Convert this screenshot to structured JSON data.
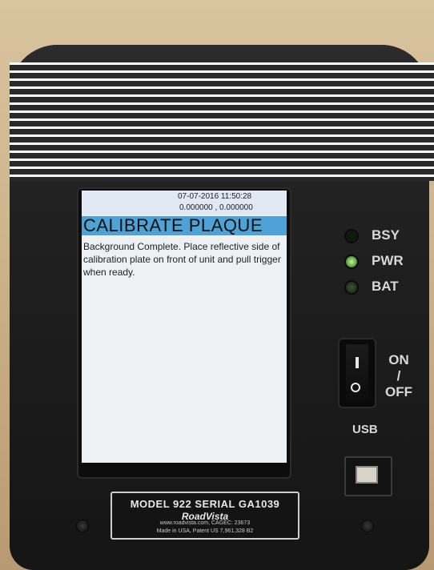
{
  "screen": {
    "date_time": "07-07-2016   11:50:28",
    "coordinates": "0.000000 , 0.000000",
    "title": "CALIBRATE PLAQUE",
    "message": "Background Complete. Place reflective side of calibration plate on front of unit and pull trigger when ready."
  },
  "indicators": [
    {
      "label": "BSY",
      "state": "off"
    },
    {
      "label": "PWR",
      "state": "on"
    },
    {
      "label": "BAT",
      "state": "dim"
    }
  ],
  "power_switch": {
    "on_label": "ON",
    "separator": "/",
    "off_label": "OFF"
  },
  "usb": {
    "label": "USB"
  },
  "nameplate": {
    "model": "MODEL 922 SERIAL GA1039",
    "brand": "RoadVista",
    "web": "www.roadvista.com, CAGEC: 23673",
    "made": "Made in USA, Patent US 7,961,328 B2"
  },
  "colors": {
    "title_banner": "#4ea2d6",
    "led_on": "#68a84a",
    "device_body": "#1c1c1c"
  }
}
